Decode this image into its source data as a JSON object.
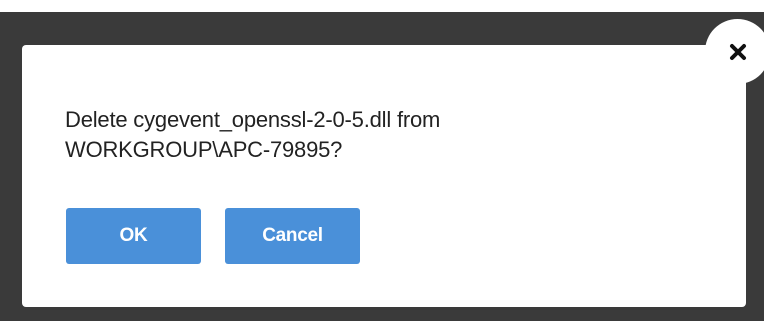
{
  "dialog": {
    "message_line1": "Delete cygevent_openssl-2-0-5.dll from",
    "message_line2": "WORKGROUP\\APC-79895?",
    "ok_label": "OK",
    "cancel_label": "Cancel",
    "close_icon": "close-icon"
  },
  "colors": {
    "backdrop": "#3a3a3a",
    "dialog_background": "#ffffff",
    "button_primary": "#4a90d9",
    "button_text": "#ffffff",
    "message_text": "#222222",
    "close_icon": "#111111"
  }
}
